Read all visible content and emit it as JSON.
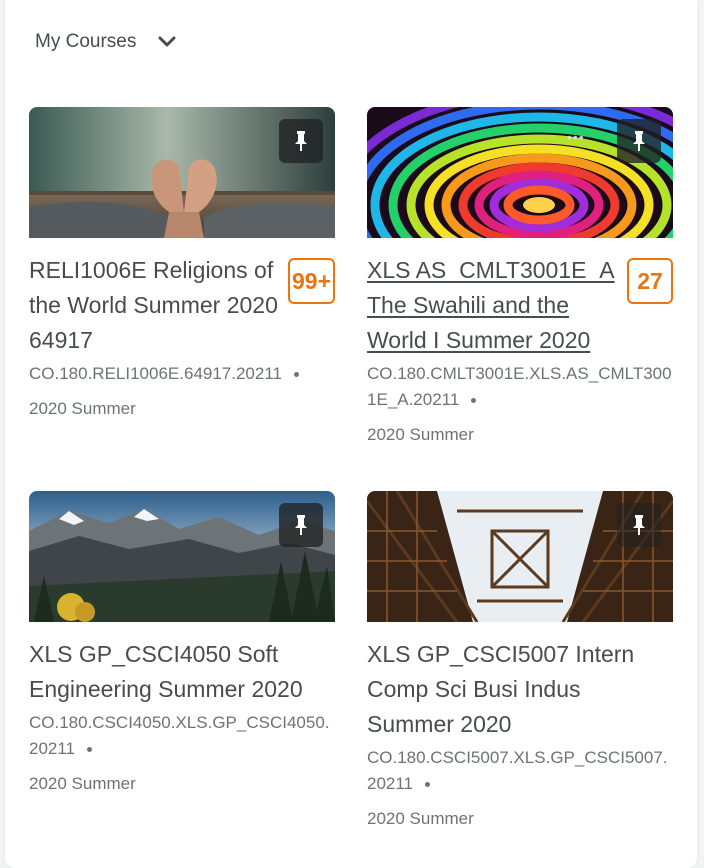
{
  "widget": {
    "title": "My Courses"
  },
  "courses": [
    {
      "title": "RELI1006E Religions of the World Summer 2020 64917",
      "code": "CO.180.RELI1006E.64917.20211",
      "term": "2020 Summer",
      "badge": "99+"
    },
    {
      "title": "XLS AS_CMLT3001E_A The Swahili and the World I Summer 2020",
      "code": "CO.180.CMLT3001E.XLS.AS_CMLT3001E_A.20211",
      "term": "2020 Summer",
      "badge": "27"
    },
    {
      "title": "XLS GP_CSCI4050 Soft Engineering Summer 2020",
      "code": "CO.180.CSCI4050.XLS.GP_CSCI4050.20211",
      "term": "2020 Summer"
    },
    {
      "title": "XLS GP_CSCI5007 Intern Comp Sci Busi Indus Summer 2020",
      "code": "CO.180.CSCI5007.XLS.GP_CSCI5007.20211",
      "term": "2020 Summer"
    }
  ],
  "colors": {
    "accent": "#e87511",
    "text": "#494c4e",
    "muted": "#6e7376"
  }
}
